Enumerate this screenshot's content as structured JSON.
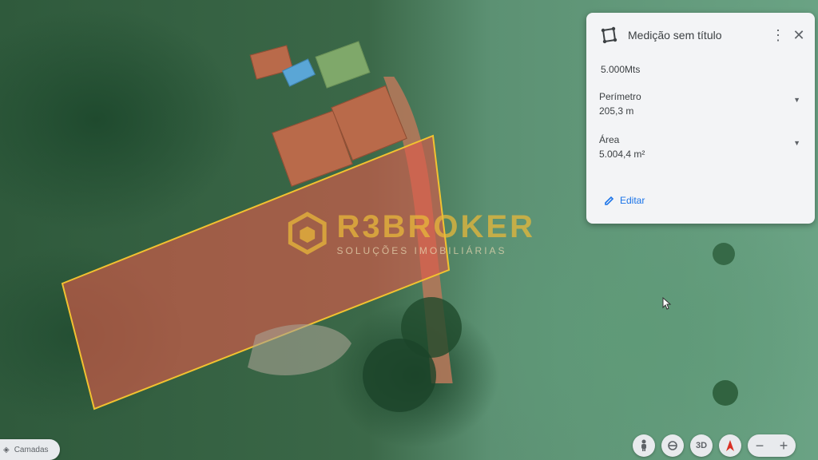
{
  "map": {
    "layers_label": "Camadas",
    "watermark": {
      "brand": "R3BROKER",
      "tagline": "SOLUÇÕES IMOBILIÁRIAS"
    },
    "plot_color": "#e05a4a",
    "plot_outline_color": "#f2c230"
  },
  "panel": {
    "title": "Medição sem título",
    "more_icon": "more-vert-icon",
    "close_icon": "close-icon",
    "note": "5.000Mts",
    "perimeter_label": "Perímetro",
    "perimeter_value": "205,3 m",
    "area_label": "Área",
    "area_value": "5.004,4 m²",
    "edit_label": "Editar"
  },
  "controls": {
    "zoom_out": "−",
    "zoom_in": "+",
    "view_3d": "3D"
  },
  "colors": {
    "panel_bg": "#f3f4f6",
    "accent": "#1a73e8",
    "watermark_gold": "#e8b83a"
  }
}
